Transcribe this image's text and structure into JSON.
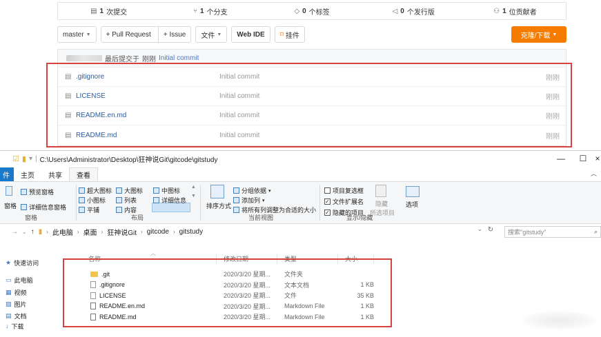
{
  "web": {
    "stats": [
      {
        "icon": "commit-icon",
        "value": "1",
        "label": "次提交"
      },
      {
        "icon": "branch-icon",
        "value": "1",
        "label": "个分支"
      },
      {
        "icon": "tag-icon",
        "value": "0",
        "label": "个标签"
      },
      {
        "icon": "release-icon",
        "value": "0",
        "label": "个发行版"
      },
      {
        "icon": "contributor-icon",
        "value": "1",
        "label": "位贡献者"
      }
    ],
    "toolbar": {
      "branch": "master",
      "pull_request": "+ Pull Request",
      "issue": "+ Issue",
      "file": "文件",
      "webide": "Web IDE",
      "pendant": "挂件",
      "clone": "克隆/下载"
    },
    "commit_bar": {
      "prefix": "最后提交于",
      "time": "刚刚",
      "message": "Initial commit"
    },
    "files": [
      {
        "name": ".gitignore",
        "commit": "Initial commit",
        "time": "刚刚"
      },
      {
        "name": "LICENSE",
        "commit": "Initial commit",
        "time": "刚刚"
      },
      {
        "name": "README.en.md",
        "commit": "Initial commit",
        "time": "刚刚"
      },
      {
        "name": "README.md",
        "commit": "Initial commit",
        "time": "刚刚"
      }
    ]
  },
  "explorer": {
    "path": "C:\\Users\\Administrator\\Desktop\\狂神说Git\\gitcode\\gitstudy",
    "tabs": {
      "file": "件",
      "home": "主页",
      "share": "共享",
      "view": "查看"
    },
    "ribbon": {
      "preview_pane": "预览窗格",
      "details_pane": "详细信息窗格",
      "pane_left": "窗格",
      "pane_group": "窗格",
      "xl_icons": "超大图标",
      "l_icons": "大图标",
      "m_icons": "中图标",
      "s_icons": "小图标",
      "list": "列表",
      "details": "详细信息",
      "tiles": "平铺",
      "content": "内容",
      "layout_group": "布局",
      "sort_by": "排序方式",
      "group_by": "分组依据",
      "add_columns": "添加列",
      "fit_columns": "将所有列调整为合适的大小",
      "current_view_group": "当前视图",
      "item_checkboxes": "项目复选框",
      "file_ext": "文件扩展名",
      "hidden_items": "隐藏的项目",
      "hide": "隐藏",
      "hide_selected": "所选项目",
      "options": "选项",
      "show_hide_group": "显示/隐藏"
    },
    "address": {
      "crumbs": [
        "此电脑",
        "桌面",
        "狂神说Git",
        "gitcode",
        "gitstudy"
      ],
      "search_placeholder": "搜索\"gitstudy\""
    },
    "nav": [
      {
        "icon": "star-icon",
        "label": "快速访问"
      },
      {
        "icon": "computer-icon",
        "label": "此电脑"
      },
      {
        "icon": "video-icon",
        "label": "视频"
      },
      {
        "icon": "picture-icon",
        "label": "图片"
      },
      {
        "icon": "document-icon",
        "label": "文档"
      },
      {
        "icon": "download-icon",
        "label": "下载"
      }
    ],
    "columns": [
      "名称",
      "修改日期",
      "类型",
      "大小"
    ],
    "files": [
      {
        "name": ".git",
        "date": "2020/3/20 星期...",
        "type": "文件夹",
        "size": "",
        "kind": "folder"
      },
      {
        "name": ".gitignore",
        "date": "2020/3/20 星期...",
        "type": "文本文档",
        "size": "1 KB",
        "kind": "file"
      },
      {
        "name": "LICENSE",
        "date": "2020/3/20 星期...",
        "type": "文件",
        "size": "35 KB",
        "kind": "file"
      },
      {
        "name": "README.en.md",
        "date": "2020/3/20 星期...",
        "type": "Markdown File",
        "size": "1 KB",
        "kind": "md"
      },
      {
        "name": "README.md",
        "date": "2020/3/20 星期...",
        "type": "Markdown File",
        "size": "1 KB",
        "kind": "md"
      }
    ]
  },
  "colors": {
    "accent_orange": "#f57c00",
    "highlight_red": "#d8423e",
    "link_blue": "#2c5b9e",
    "ribbon_file_tab": "#1979ca"
  }
}
